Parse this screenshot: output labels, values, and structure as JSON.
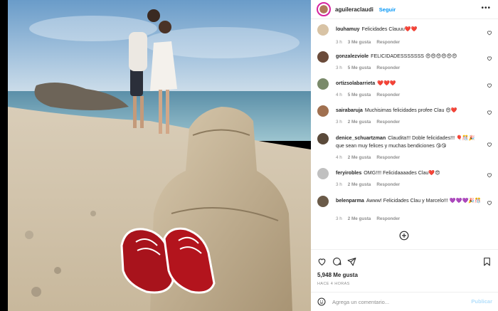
{
  "post": {
    "username": "aguileraclaudi",
    "follow_label": "Seguir",
    "more_label": "•••",
    "likes_text": "5,948 Me gusta",
    "time_text": "HACE 4 HORAS"
  },
  "colors": {
    "accent": "#0095f6",
    "muted": "#8e8e8e",
    "text": "#262626",
    "publish_disabled": "#b2dffc"
  },
  "comments": [
    {
      "user": "louhamuy",
      "text": "Felicidades Clauuu❤️❤️",
      "time": "3 h",
      "likes": "3 Me gusta",
      "reply": "Responder",
      "avatar_color": "#d8c3a5"
    },
    {
      "user": "gonzalezviole",
      "text": "FELICIDADESSSSSSS 😍😍😍😍😍😍",
      "time": "3 h",
      "likes": "5 Me gusta",
      "reply": "Responder",
      "avatar_color": "#6b4b3a"
    },
    {
      "user": "ortizsolabarrieta",
      "text": "❤️❤️❤️",
      "time": "4 h",
      "likes": "5 Me gusta",
      "reply": "Responder",
      "avatar_color": "#7a8a6a"
    },
    {
      "user": "sairabaruja",
      "text": "Muchisimas felicidades profee Clau 😍❤️",
      "time": "3 h",
      "likes": "2 Me gusta",
      "reply": "Responder",
      "avatar_color": "#a07050"
    },
    {
      "user": "denice_schuartzman",
      "text": "Claudita!!! Doble felicidades!!! 🎈🎊🎉 que sean muy felices y muchas bendiciones 😘😘",
      "time": "4 h",
      "likes": "2 Me gusta",
      "reply": "Responder",
      "avatar_color": "#5a4a3a"
    },
    {
      "user": "feryirobles",
      "text": "OMG!!!! Felicidaaaades Clau❤️😍",
      "time": "3 h",
      "likes": "2 Me gusta",
      "reply": "Responder",
      "avatar_color": "#c0c0c0"
    },
    {
      "user": "belenparma",
      "text": "Awww! Felicidades Clau y Marcelo!!! 💜💜💜🎉🎊",
      "time": "3 h",
      "likes": "2 Me gusta",
      "reply": "Responder",
      "avatar_color": "#6a5a48"
    }
  ],
  "add_comment": {
    "placeholder": "Agrega un comentario...",
    "publish_label": "Publicar"
  },
  "icons": {
    "like": "heart-icon",
    "comment": "comment-icon",
    "share": "share-icon",
    "save": "bookmark-icon",
    "more_comments": "plus-circle-icon",
    "emoji": "smile-icon"
  }
}
